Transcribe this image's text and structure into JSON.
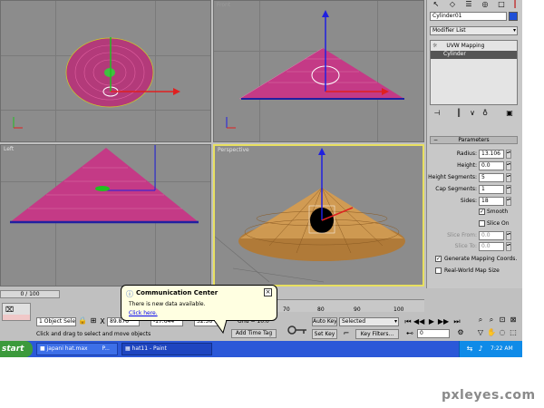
{
  "viewports": {
    "top_left_label": "",
    "top_right_label": "Front",
    "left_label": "Left",
    "perspective_label": "Perspective"
  },
  "panel": {
    "object_name": "Cylinder01",
    "modifier_list": "Modifier List",
    "stack_items": [
      "UVW Mapping",
      "Cylinder"
    ],
    "rollout_title": "Parameters",
    "params": [
      {
        "label": "Radius:",
        "value": "13.106"
      },
      {
        "label": "Height:",
        "value": "0.0"
      },
      {
        "label": "Height Segments:",
        "value": "5"
      },
      {
        "label": "Cap Segments:",
        "value": "1"
      },
      {
        "label": "Sides:",
        "value": "18"
      }
    ],
    "smooth": "Smooth",
    "slice_on": "Slice On",
    "slice_from_label": "Slice From:",
    "slice_from": "0.0",
    "slice_to_label": "Slice To:",
    "slice_to": "0.0",
    "gen_mapping": "Generate Mapping Coords.",
    "real_world": "Real-World Map Size",
    "accent": "#1f4fd6"
  },
  "timeline": {
    "frame": "0 / 100",
    "ticks": [
      "70",
      "80",
      "90",
      "100"
    ]
  },
  "status": {
    "selection": "1 Object Sele",
    "x_label": "X",
    "x": "89.876",
    "y": "-17.644",
    "z": "32.36",
    "grid": "Grid = 10.0",
    "prompt": "Click and drag to select and move objects",
    "add_time_tag": "Add Time Tag",
    "auto_key": "Auto Key",
    "set_key": "Set Key",
    "selected": "Selected",
    "key_filters": "Key Filters...",
    "frame_value": "0"
  },
  "bubble": {
    "title": "Communication Center",
    "text": "There is new data available.",
    "link": "Click here."
  },
  "taskbar": {
    "start": "start",
    "items": [
      "japani hat.max",
      "P...",
      "hat11 - Paint"
    ],
    "clock": "7:22 AM"
  },
  "watermark": "pxleyes.com"
}
